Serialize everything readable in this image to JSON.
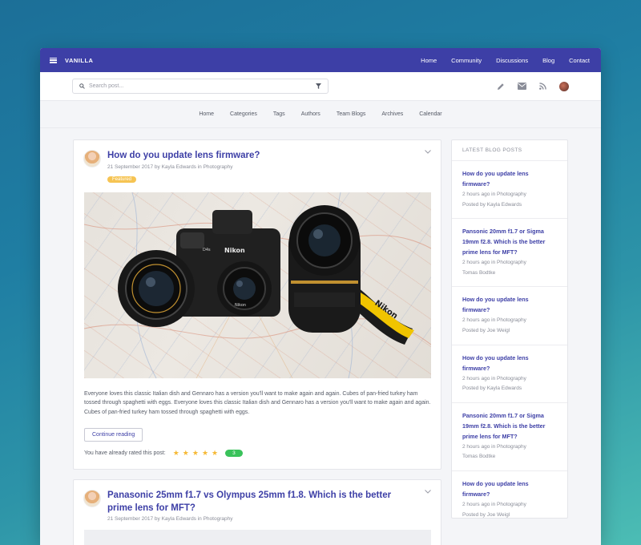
{
  "topbar": {
    "brand": "VANILLA",
    "nav": [
      "Home",
      "Community",
      "Discussions",
      "Blog",
      "Contact"
    ]
  },
  "search": {
    "placeholder": "Search post..."
  },
  "subnav": [
    "Home",
    "Categories",
    "Tags",
    "Authors",
    "Team Blogs",
    "Archives",
    "Calendar"
  ],
  "posts": [
    {
      "title": "How do you update lens firmware?",
      "meta": "21 September 2017 by Kayla Edwards in Photography",
      "badge": "Featured",
      "excerpt": "Everyone loves this classic Italian dish and Gennaro has a version you'll want to make again and again. Cubes of pan-fried turkey ham tossed through spaghetti with eggs. Everyone loves this classic Italian dish and Gennaro has a version you'll want to make again and again. Cubes of pan-fried turkey ham tossed through spaghetti with eggs.",
      "button": "Continue reading",
      "rating_label": "You have already rated this post:",
      "rating_stars": 5,
      "rating_count": "3"
    },
    {
      "title": "Panasonic 25mm f1.7 vs Olympus 25mm f1.8. Which is the better prime lens for MFT?",
      "meta": "21 September 2017 by Kayla Edwards in Photography"
    }
  ],
  "sidebar": {
    "heading": "LATEST BLOG POSTS",
    "items": [
      {
        "title": "How do you update lens firmware?",
        "time": "2 hours ago in Photography",
        "author": "Posted by Kayla Edwards"
      },
      {
        "title": "Pansonic 20mm f1.7 or Sigma 19mm f2.8. Which is the better prime lens for MFT?",
        "time": "2 hours ago in Photography",
        "author": "Tomas Bodtke"
      },
      {
        "title": "How do you update lens firmware?",
        "time": "2 hours ago in Photography",
        "author": "Posted by Joe Weigl"
      },
      {
        "title": "How do you update lens firmware?",
        "time": "2 hours ago in Photography",
        "author": "Posted by Kayla Edwards"
      },
      {
        "title": "Pansonic 20mm f1.7 or Sigma 19mm f2.8. Which is the better prime lens for MFT?",
        "time": "2 hours ago in Photography",
        "author": "Tomas Bodtke"
      },
      {
        "title": "How do you update lens firmware?",
        "time": "2 hours ago in Photography",
        "author": "Posted by Joe Weigl"
      }
    ]
  },
  "photo_text": {
    "camera_brand": "Nikon",
    "camera_model": "D4s",
    "lens_brand": "Nikon",
    "strap_text": "Nikon"
  },
  "colors": {
    "brand": "#3d3fa6",
    "star": "#f6b935",
    "badge": "#f6c453",
    "count": "#3ac25b"
  },
  "icons": [
    "menu-icon",
    "search-icon",
    "filter-icon",
    "pencil-icon",
    "mail-icon",
    "rss-icon",
    "chevron-down-icon"
  ]
}
